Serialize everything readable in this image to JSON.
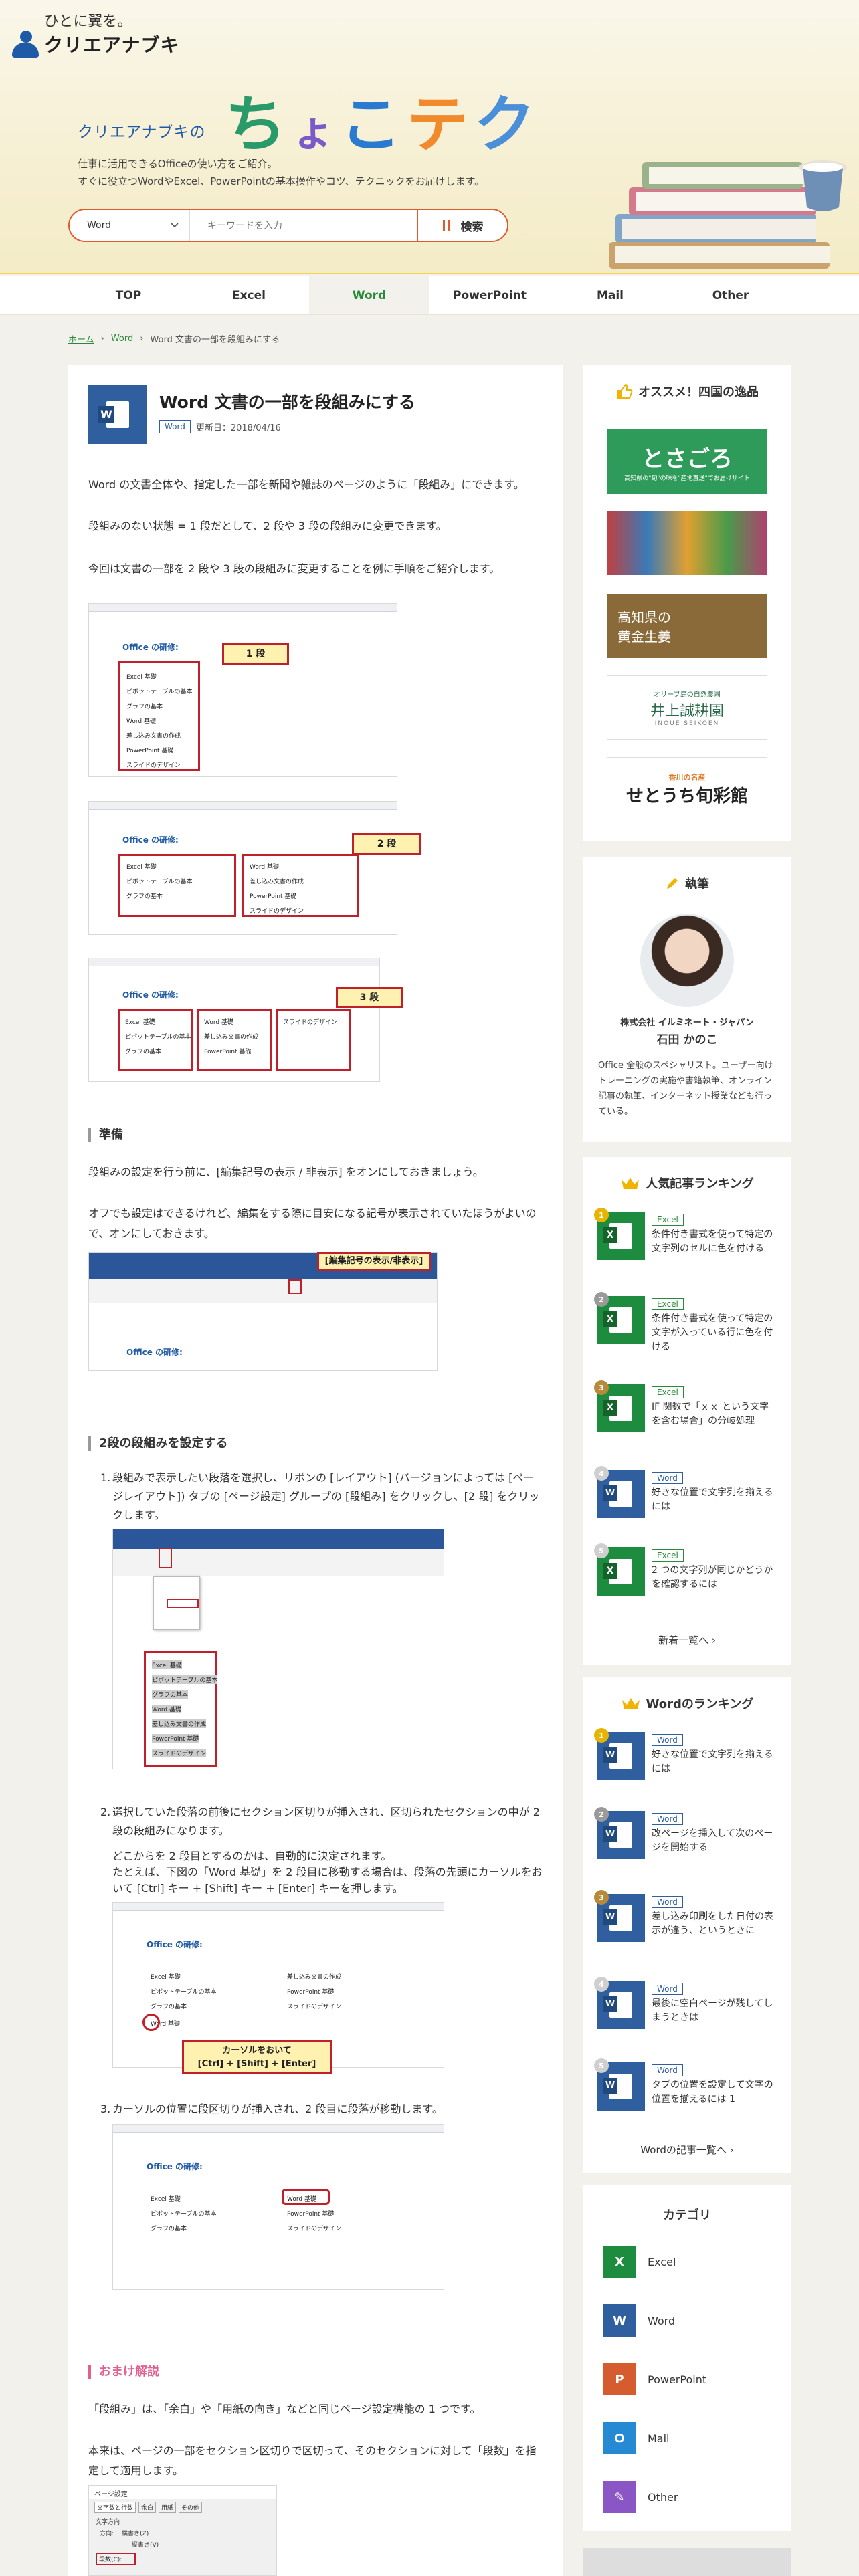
{
  "header": {
    "logo_tagline": "ひとに翼を。",
    "logo_name": "クリエアナブキ",
    "hero_sub": "クリエアナブキの",
    "hero_title_chars": [
      "ち",
      "ょ",
      "こ",
      "テ",
      "ク"
    ],
    "hero_colors": [
      "#2a9a6b",
      "#7a59c8",
      "#2a7bd0",
      "#f08a2a",
      "#4a8fd8"
    ],
    "hero_desc_1": "仕事に活用できるOfficeの使い方をご紹介。",
    "hero_desc_2": "すぐに役立つWordやExcel、PowerPointの基本操作やコツ、テクニックをお届けします。"
  },
  "search": {
    "select_value": "Word",
    "placeholder": "キーワードを入力",
    "button_label": "検索"
  },
  "nav": [
    "TOP",
    "Excel",
    "Word",
    "PowerPoint",
    "Mail",
    "Other"
  ],
  "breadcrumb": {
    "home": "ホーム",
    "cat": "Word",
    "current": "Word 文書の一部を段組みにする"
  },
  "article": {
    "title": "Word 文書の一部を段組みにする",
    "tag": "Word",
    "updated": "更新日：2018/04/16",
    "intro_1": "Word の文書全体や、指定した一部を新聞や雑誌のページのように「段組み」にできます。",
    "intro_2": "段組みのない状態 = 1 段だとして、2 段や 3 段の段組みに変更できます。",
    "intro_3": "今回は文書の一部を 2 段や 3 段の段組みに変更することを例に手順をご紹介します。",
    "callout_1": "1 段",
    "callout_2": "2 段",
    "callout_3": "3 段",
    "sample_title": "Office の研修:",
    "sample_items": [
      "Excel 基礎",
      "ピボットテーブルの基本",
      "グラフの基本",
      "Word 基礎",
      "差し込み文書の作成",
      "PowerPoint 基礎",
      "スライドのデザイン"
    ],
    "h_prep": "準備",
    "prep_1": "段組みの設定を行う前に、[編集記号の表示 / 非表示] をオンにしておきましょう。",
    "prep_2": "オフでも設定はできるけれど、編集をする際に目安になる記号が表示されていたほうがよいので、オンにしておきます。",
    "prep_callout": "[編集記号の表示/非表示]",
    "h_two": "2段の段組みを設定する",
    "step1_num": "1.",
    "step1": "段組みで表示したい段落を選択し、リボンの [レイアウト] (バージョンによっては [ページレイアウト]) タブの [ページ設定] グループの [段組み] をクリックし、[2 段] をクリックします。",
    "step2_num": "2.",
    "step2": "選択していた段落の前後にセクション区切りが挿入され、区切られたセクションの中が 2 段の段組みになります。",
    "step2b_1": "どこからを 2 段目とするのかは、自動的に決定されます。",
    "step2b_2": "たとえば、下図の「Word 基礎」を 2 段目に移動する場合は、段落の先頭にカーソルをおいて [Ctrl] キー + [Shift] キー + [Enter] キーを押します。",
    "step2_callout_1": "カーソルをおいて",
    "step2_callout_2": "[Ctrl] + [Shift] + [Enter]",
    "step3_num": "3.",
    "step3": "カーソルの位置に段区切りが挿入され、2 段目に段落が移動します。",
    "h_extra": "おまけ解説",
    "extra_1": "「段組み」は、「余白」や「用紙の向き」などと同じページ設定機能の 1 つです。",
    "extra_2": "本来は、ページの一部をセクション区切りで区切って、そのセクションに対して「段数」を指定して適用します。",
    "dialog_title": "ページ設定",
    "dialog_tabs": [
      "文字数と行数",
      "余白",
      "用紙",
      "その他"
    ],
    "dialog_row_1": "文字方向",
    "dialog_row_2": "方向:",
    "dialog_opt_1": "横書き(Z)",
    "dialog_opt_2": "縦書き(V)",
    "dialog_row_3": "段数(C):"
  },
  "sidebar": {
    "recommend_title": "オススメ！四国の逸品",
    "ad_tosa": "とさごろ",
    "ad_tosa_sub": "高知県の\"旬\"の味を\"産地直送\"でお届けサイト",
    "ad_kochi": "高知県の\n黄金生姜",
    "ad_olive_sub": "オリーブ島の自然農園",
    "ad_olive": "井上誠耕園",
    "ad_olive_en": "INOUE SEIKOEN",
    "ad_setouchi_pre": "香川の名産",
    "ad_setouchi": "せとうち旬彩館",
    "author_title": "執筆",
    "author_company": "株式会社 イルミネート・ジャパン",
    "author_name": "石田 かのこ",
    "author_bio": "Office 全般のスペシャリスト。ユーザー向けトレーニングの実施や書籍執筆、オンライン記事の執筆、インターネット授業なども行っている。",
    "rank_title": "人気記事ランキング",
    "rank": [
      {
        "tag": "Excel",
        "text": "条件付き書式を使って特定の文字列のセルに色を付ける",
        "type": "xl",
        "medal": "#e7b400"
      },
      {
        "tag": "Excel",
        "text": "条件付き書式を使って特定の文字が入っている行に色を付ける",
        "type": "xl",
        "medal": "#9a9a9a"
      },
      {
        "tag": "Excel",
        "text": "IF 関数で「ｘｘ という文字を含む場合」の分岐処理",
        "type": "xl",
        "medal": "#b58a3a"
      },
      {
        "tag": "Word",
        "text": "好きな位置で文字列を揃えるには",
        "type": "wd",
        "medal": "#cfcfcf"
      },
      {
        "tag": "Excel",
        "text": "2 つの文字列が同じかどうかを確認するには",
        "type": "xl",
        "medal": "#cfcfcf"
      }
    ],
    "rank_more": "新着一覧へ",
    "word_rank_title": "Wordのランキング",
    "word_rank": [
      {
        "tag": "Word",
        "text": "好きな位置で文字列を揃えるには",
        "medal": "#e7b400"
      },
      {
        "tag": "Word",
        "text": "改ページを挿入して次のページを開始する",
        "medal": "#9a9a9a"
      },
      {
        "tag": "Word",
        "text": "差し込み印刷をした日付の表示が違う、というときに",
        "medal": "#b58a3a"
      },
      {
        "tag": "Word",
        "text": "最後に空白ページが残してしまうときは",
        "medal": "#cfcfcf"
      },
      {
        "tag": "Word",
        "text": "タブの位置を設定して文字の位置を揃えるには 1",
        "medal": "#cfcfcf"
      }
    ],
    "word_more": "Wordの記事一覧へ",
    "cat_title": "カテゴリ",
    "categories": [
      {
        "label": "Excel",
        "icon": "X"
      },
      {
        "label": "Word",
        "icon": "W"
      },
      {
        "label": "PowerPoint",
        "icon": "P"
      },
      {
        "label": "Mail",
        "icon": "O"
      },
      {
        "label": "Other",
        "icon": "✎"
      }
    ]
  }
}
